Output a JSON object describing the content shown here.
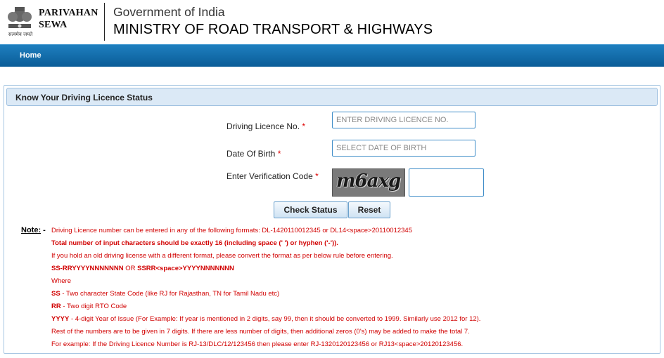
{
  "header": {
    "emblem_caption": "सत्यमेव जयते",
    "brand_line1": "PARIVAHAN",
    "brand_line2": "SEWA",
    "gov_title": "Government of India",
    "ministry_title": "MINISTRY OF ROAD TRANSPORT & HIGHWAYS"
  },
  "nav": {
    "home": "Home"
  },
  "panel": {
    "title": "Know Your Driving Licence Status",
    "dl_label": "Driving Licence No.",
    "dl_placeholder": "ENTER DRIVING LICENCE NO.",
    "dob_label": "Date Of Birth",
    "dob_placeholder": "SELECT DATE OF BIRTH",
    "captcha_label": "Enter Verification Code",
    "captcha_text": "m6axg",
    "required_mark": "*",
    "check_button": "Check Status",
    "reset_button": "Reset"
  },
  "notes": {
    "label": "Note:",
    "dash": "-",
    "line1": "Driving Licence number can be entered in any of the following formats: DL-1420110012345 or DL14<space>20110012345",
    "line2": "Total number of input characters should be exactly 16 (including space (' ') or hyphen ('-')).",
    "line3": "If you hold an old driving license with a different format, please convert the format as per below rule before entering.",
    "line4_a": "SS-RRYYYYNNNNNNN",
    "line4_or": " OR ",
    "line4_b": "SSRR<space>YYYYNNNNNNN",
    "line5": "Where",
    "line6_key": "SS",
    "line6_text": " - Two character State Code (like RJ for Rajasthan, TN for Tamil Nadu etc)",
    "line7_key": "RR",
    "line7_text": " - Two digit RTO Code",
    "line8_key": "YYYY",
    "line8_text": " - 4-digit Year of Issue (For Example: If year is mentioned in 2 digits, say 99, then it should be converted to 1999. Similarly use 2012 for 12).",
    "line9": "Rest of the numbers are to be given in 7 digits. If there are less number of digits, then additional zeros (0's) may be added to make the total 7.",
    "line10": "For example: If the Driving Licence Number is RJ-13/DLC/12/123456 then please enter RJ-1320120123456 or RJ13<space>20120123456."
  }
}
